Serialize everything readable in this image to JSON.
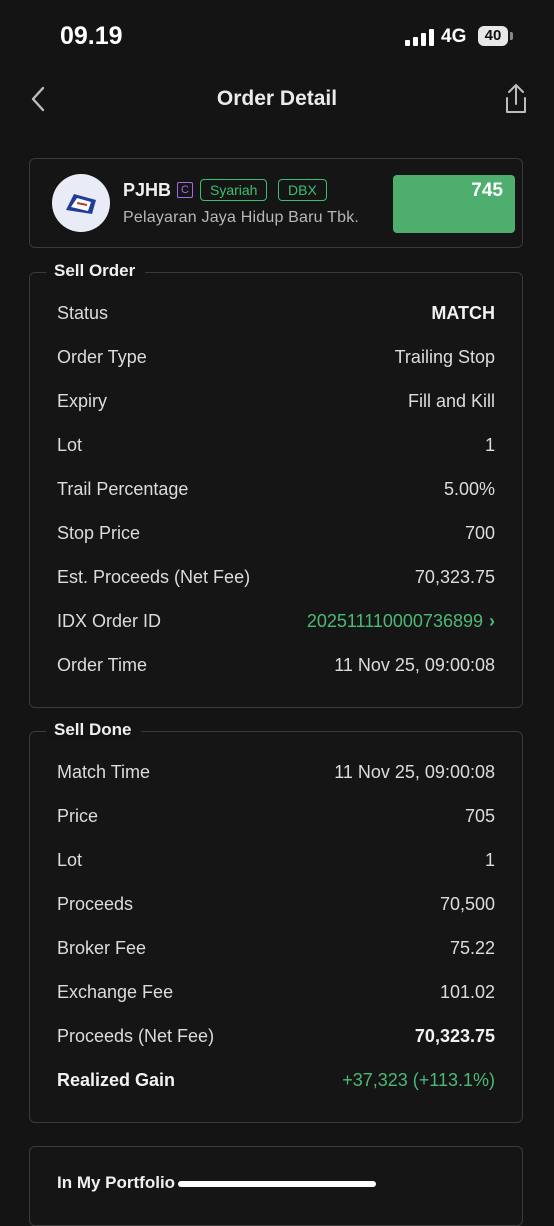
{
  "status_bar": {
    "time": "09.19",
    "network": "4G",
    "battery": "40"
  },
  "nav": {
    "title": "Order Detail"
  },
  "stock": {
    "ticker": "PJHB",
    "badge": "C",
    "tags": [
      "Syariah",
      "DBX"
    ],
    "company": "Pelayaran Jaya Hidup Baru Tbk.",
    "price": "745",
    "price_color": "#4eae6e"
  },
  "sell_order": {
    "title": "Sell Order",
    "rows": [
      {
        "label": "Status",
        "value": "MATCH"
      },
      {
        "label": "Order Type",
        "value": "Trailing Stop"
      },
      {
        "label": "Expiry",
        "value": "Fill and Kill"
      },
      {
        "label": "Lot",
        "value": "1"
      },
      {
        "label": "Trail Percentage",
        "value": "5.00%"
      },
      {
        "label": "Stop Price",
        "value": "700"
      },
      {
        "label": "Est. Proceeds (Net Fee)",
        "value": "70,323.75"
      },
      {
        "label": "IDX Order ID",
        "value": "202511110000736899"
      },
      {
        "label": "Order Time",
        "value": "11 Nov 25, 09:00:08"
      }
    ]
  },
  "sell_done": {
    "title": "Sell Done",
    "rows": [
      {
        "label": "Match Time",
        "value": "11 Nov 25, 09:00:08"
      },
      {
        "label": "Price",
        "value": "705"
      },
      {
        "label": "Lot",
        "value": "1"
      },
      {
        "label": "Proceeds",
        "value": "70,500"
      },
      {
        "label": "Broker Fee",
        "value": "75.22"
      },
      {
        "label": "Exchange Fee",
        "value": "101.02"
      },
      {
        "label": "Proceeds (Net Fee)",
        "value": "70,323.75"
      },
      {
        "label": "Realized Gain",
        "value": "+37,323 (+113.1%)"
      }
    ]
  },
  "portfolio": {
    "title": "In My Portfolio"
  },
  "colors": {
    "accent_green": "#4cb877",
    "background": "#141414",
    "badge_purple": "#a36ce6"
  }
}
